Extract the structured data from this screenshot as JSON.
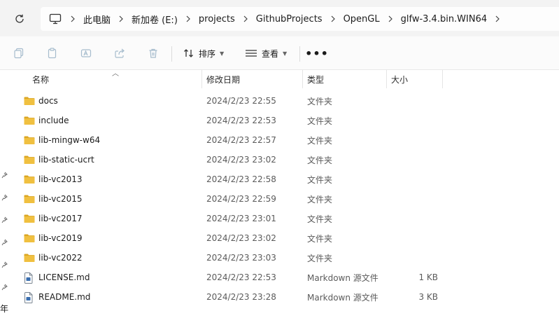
{
  "address": {
    "crumbs": [
      "此电脑",
      "新加卷 (E:)",
      "projects",
      "GithubProjects",
      "OpenGL",
      "glfw-3.4.bin.WIN64"
    ]
  },
  "toolbar": {
    "sort_label": "排序",
    "view_label": "查看",
    "more_label": "•••"
  },
  "columns": {
    "name": "名称",
    "date": "修改日期",
    "type": "类型",
    "size": "大小"
  },
  "files": [
    {
      "name": "docs",
      "date": "2024/2/23 22:55",
      "type": "文件夹",
      "size": "",
      "kind": "folder"
    },
    {
      "name": "include",
      "date": "2024/2/23 22:53",
      "type": "文件夹",
      "size": "",
      "kind": "folder"
    },
    {
      "name": "lib-mingw-w64",
      "date": "2024/2/23 22:57",
      "type": "文件夹",
      "size": "",
      "kind": "folder"
    },
    {
      "name": "lib-static-ucrt",
      "date": "2024/2/23 23:02",
      "type": "文件夹",
      "size": "",
      "kind": "folder"
    },
    {
      "name": "lib-vc2013",
      "date": "2024/2/23 22:58",
      "type": "文件夹",
      "size": "",
      "kind": "folder"
    },
    {
      "name": "lib-vc2015",
      "date": "2024/2/23 22:59",
      "type": "文件夹",
      "size": "",
      "kind": "folder"
    },
    {
      "name": "lib-vc2017",
      "date": "2024/2/23 23:01",
      "type": "文件夹",
      "size": "",
      "kind": "folder"
    },
    {
      "name": "lib-vc2019",
      "date": "2024/2/23 23:02",
      "type": "文件夹",
      "size": "",
      "kind": "folder"
    },
    {
      "name": "lib-vc2022",
      "date": "2024/2/23 23:03",
      "type": "文件夹",
      "size": "",
      "kind": "folder"
    },
    {
      "name": "LICENSE.md",
      "date": "2024/2/23 22:53",
      "type": "Markdown 源文件",
      "size": "1 KB",
      "kind": "file"
    },
    {
      "name": "README.md",
      "date": "2024/2/23 23:28",
      "type": "Markdown 源文件",
      "size": "3 KB",
      "kind": "file"
    }
  ],
  "left_pane": {
    "partial_char": "年"
  },
  "colors": {
    "folder": "#f0c040",
    "folder_dark": "#dba623",
    "bar_bg": "#f3f3f3"
  }
}
